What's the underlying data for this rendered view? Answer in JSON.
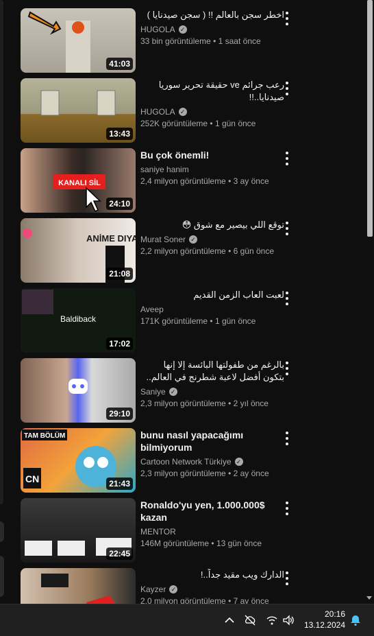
{
  "videos": [
    {
      "title": "اخطر سجن بالعالم !! ( سجن صيدنايا )",
      "rtl": true,
      "channel": "HUGOLA",
      "verified": true,
      "views": "33 bin görüntüleme",
      "age": "1 saat önce",
      "duration": "41:03"
    },
    {
      "title": "رعب جرائم ve حقيقة تحرير سوريا صيدنايا..!!",
      "rtl": true,
      "channel": "HUGOLA",
      "verified": true,
      "views": "252K görüntüleme",
      "age": "1 gün önce",
      "duration": "13:43"
    },
    {
      "title": "Bu çok önemli!",
      "rtl": false,
      "channel": "saniye hanim",
      "verified": false,
      "views": "2,4 milyon görüntüleme",
      "age": "3 ay önce",
      "duration": "24:10",
      "thumb_text": "KANALI SİL"
    },
    {
      "title": "توقع اللي بيصير مع شوق 😳",
      "rtl": true,
      "channel": "Murat Soner",
      "verified": true,
      "views": "2,2 milyon görüntüleme",
      "age": "6 gün önce",
      "duration": "21:08",
      "thumb_text": "ANİME DIYARI"
    },
    {
      "title": "لعبت العاب الزمن القديم",
      "rtl": true,
      "channel": "Aveep",
      "verified": false,
      "views": "171K görüntüleme",
      "age": "1 gün önce",
      "duration": "17:02",
      "thumb_text": "Baldiback"
    },
    {
      "title": "بالرغم من طفولتها البائسة إلا إنها بتكون أفضل لاعبة شطرنج في العالم.. ملخص ...",
      "rtl": true,
      "channel": "Saniye",
      "verified": true,
      "views": "2,3 milyon görüntüleme",
      "age": "2 yıl önce",
      "duration": "29:10"
    },
    {
      "title": "bunu nasıl yapacağımı bilmiyorum",
      "rtl": false,
      "channel": "Cartoon Network Türkiye",
      "verified": true,
      "views": "2,3 milyon görüntüleme",
      "age": "2 ay önce",
      "duration": "21:43",
      "thumb_text": "TAM BÖLÜM"
    },
    {
      "title": "Ronaldo'yu yen, 1.000.000$ kazan",
      "rtl": false,
      "channel": "MENTOR",
      "verified": false,
      "views": "146M görüntüleme",
      "age": "13 gün önce",
      "duration": "22:45"
    },
    {
      "title": "الدارك ويب مقيد جداً..!",
      "rtl": true,
      "channel": "Kayzer",
      "verified": true,
      "views": "2,0 milyon görüntüleme",
      "age": "7 ay önce",
      "duration": ""
    }
  ],
  "taskbar": {
    "time": "20:16",
    "date": "13.12.2024"
  },
  "icons": {
    "chevron": "chevron-up-icon",
    "network": "network-disconnected-icon",
    "wifi": "wifi-icon",
    "volume": "volume-icon",
    "bell": "notification-bell-icon"
  },
  "colors": {
    "background": "#0f0f0f",
    "text": "#f1f1f1",
    "secondary": "#aaaaaa",
    "taskbar": "#202020"
  }
}
